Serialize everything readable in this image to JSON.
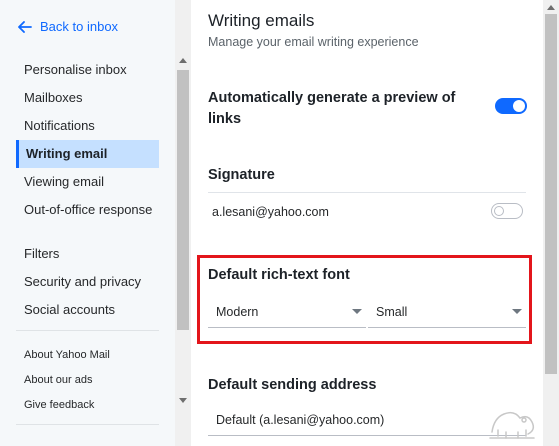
{
  "sidebar": {
    "back_label": "Back to inbox",
    "items": [
      {
        "label": "Personalise inbox"
      },
      {
        "label": "Mailboxes"
      },
      {
        "label": "Notifications"
      },
      {
        "label": "Writing email"
      },
      {
        "label": "Viewing email"
      },
      {
        "label": "Out-of-office response"
      },
      {
        "label": "Filters"
      },
      {
        "label": "Security and privacy"
      },
      {
        "label": "Social accounts"
      }
    ],
    "active_item": "Writing email",
    "footer": [
      {
        "label": "About Yahoo Mail"
      },
      {
        "label": "About our ads"
      },
      {
        "label": "Give feedback"
      }
    ]
  },
  "main": {
    "title": "Writing emails",
    "subtitle": "Manage your email writing experience",
    "link_preview": {
      "label": "Automatically generate a preview of links",
      "enabled": true
    },
    "signature": {
      "label": "Signature",
      "account": "a.lesani@yahoo.com",
      "enabled": false
    },
    "rich_text_font": {
      "label": "Default rich-text font",
      "font": "Modern",
      "size": "Small"
    },
    "sending_address": {
      "label": "Default sending address",
      "value": "Default (a.lesani@yahoo.com)"
    }
  },
  "colors": {
    "accent": "#0f69ff",
    "active_nav_bg": "#c5e0ff",
    "highlight_border": "#e3151b",
    "sidebar_bg": "#f5f8fa"
  },
  "icons": {
    "back": "arrow-left-icon",
    "dropdown": "caret-down-icon"
  }
}
